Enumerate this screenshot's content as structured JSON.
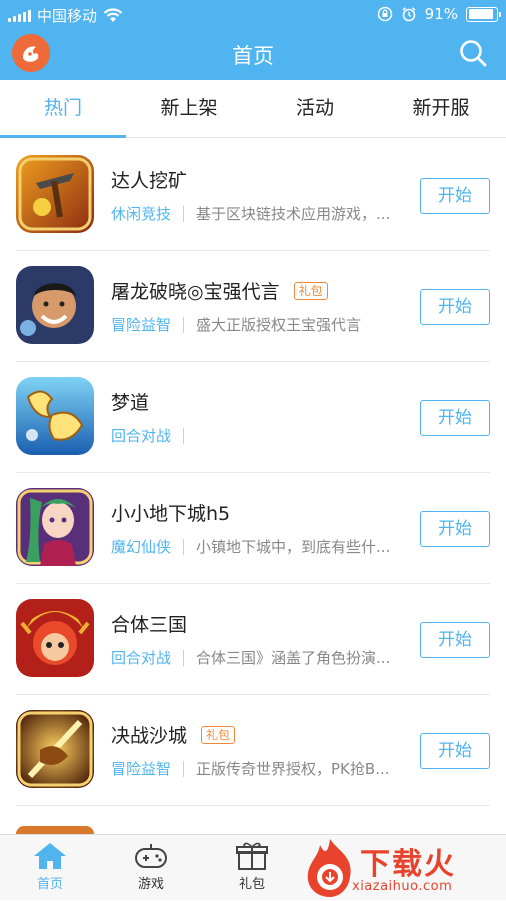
{
  "status_bar": {
    "carrier": "中国移动",
    "battery": "91%",
    "battery_level": 0.91
  },
  "header": {
    "title": "首页",
    "logo_icon": "app-logo-icon",
    "search_icon": "search-icon"
  },
  "tabs": [
    {
      "label": "热门",
      "active": true
    },
    {
      "label": "新上架",
      "active": false
    },
    {
      "label": "活动",
      "active": false
    },
    {
      "label": "新开服",
      "active": false
    }
  ],
  "games": [
    {
      "name": "达人挖矿",
      "gift": "",
      "category": "休闲竞技",
      "desc": "基于区块链技术应用游戏，...",
      "button": "开始",
      "icon_colors": [
        "#8a2b12",
        "#f0a020"
      ]
    },
    {
      "name": "屠龙破晓◎宝强代言",
      "gift": "礼包",
      "category": "冒险益智",
      "desc": "盛大正版授权王宝强代言",
      "button": "开始",
      "icon_colors": [
        "#2b3a66",
        "#d89a6a"
      ]
    },
    {
      "name": "梦道",
      "gift": "",
      "category": "回合对战",
      "desc": "",
      "button": "开始",
      "icon_colors": [
        "#1a5fb0",
        "#7fd3f5"
      ]
    },
    {
      "name": "小小地下城h5",
      "gift": "",
      "category": "魔幻仙侠",
      "desc": "小镇地下城中，到底有些什...",
      "button": "开始",
      "icon_colors": [
        "#5a2f7a",
        "#f3b6c8"
      ]
    },
    {
      "name": "合体三国",
      "gift": "",
      "category": "回合对战",
      "desc": "合体三国》涵盖了角色扮演...",
      "button": "开始",
      "icon_colors": [
        "#b3201a",
        "#f0b030"
      ]
    },
    {
      "name": "决战沙城",
      "gift": "礼包",
      "category": "冒险益智",
      "desc": "正版传奇世界授权，PK抢B...",
      "button": "开始",
      "icon_colors": [
        "#4a1e08",
        "#f0a030"
      ]
    }
  ],
  "bottom_nav": [
    {
      "label": "首页",
      "icon": "home-icon",
      "active": true
    },
    {
      "label": "游戏",
      "icon": "gamepad-icon",
      "active": false
    },
    {
      "label": "礼包",
      "icon": "gift-box-icon",
      "active": false
    }
  ],
  "watermark": {
    "text": "下载火",
    "url": "xiazaihuo.com"
  }
}
